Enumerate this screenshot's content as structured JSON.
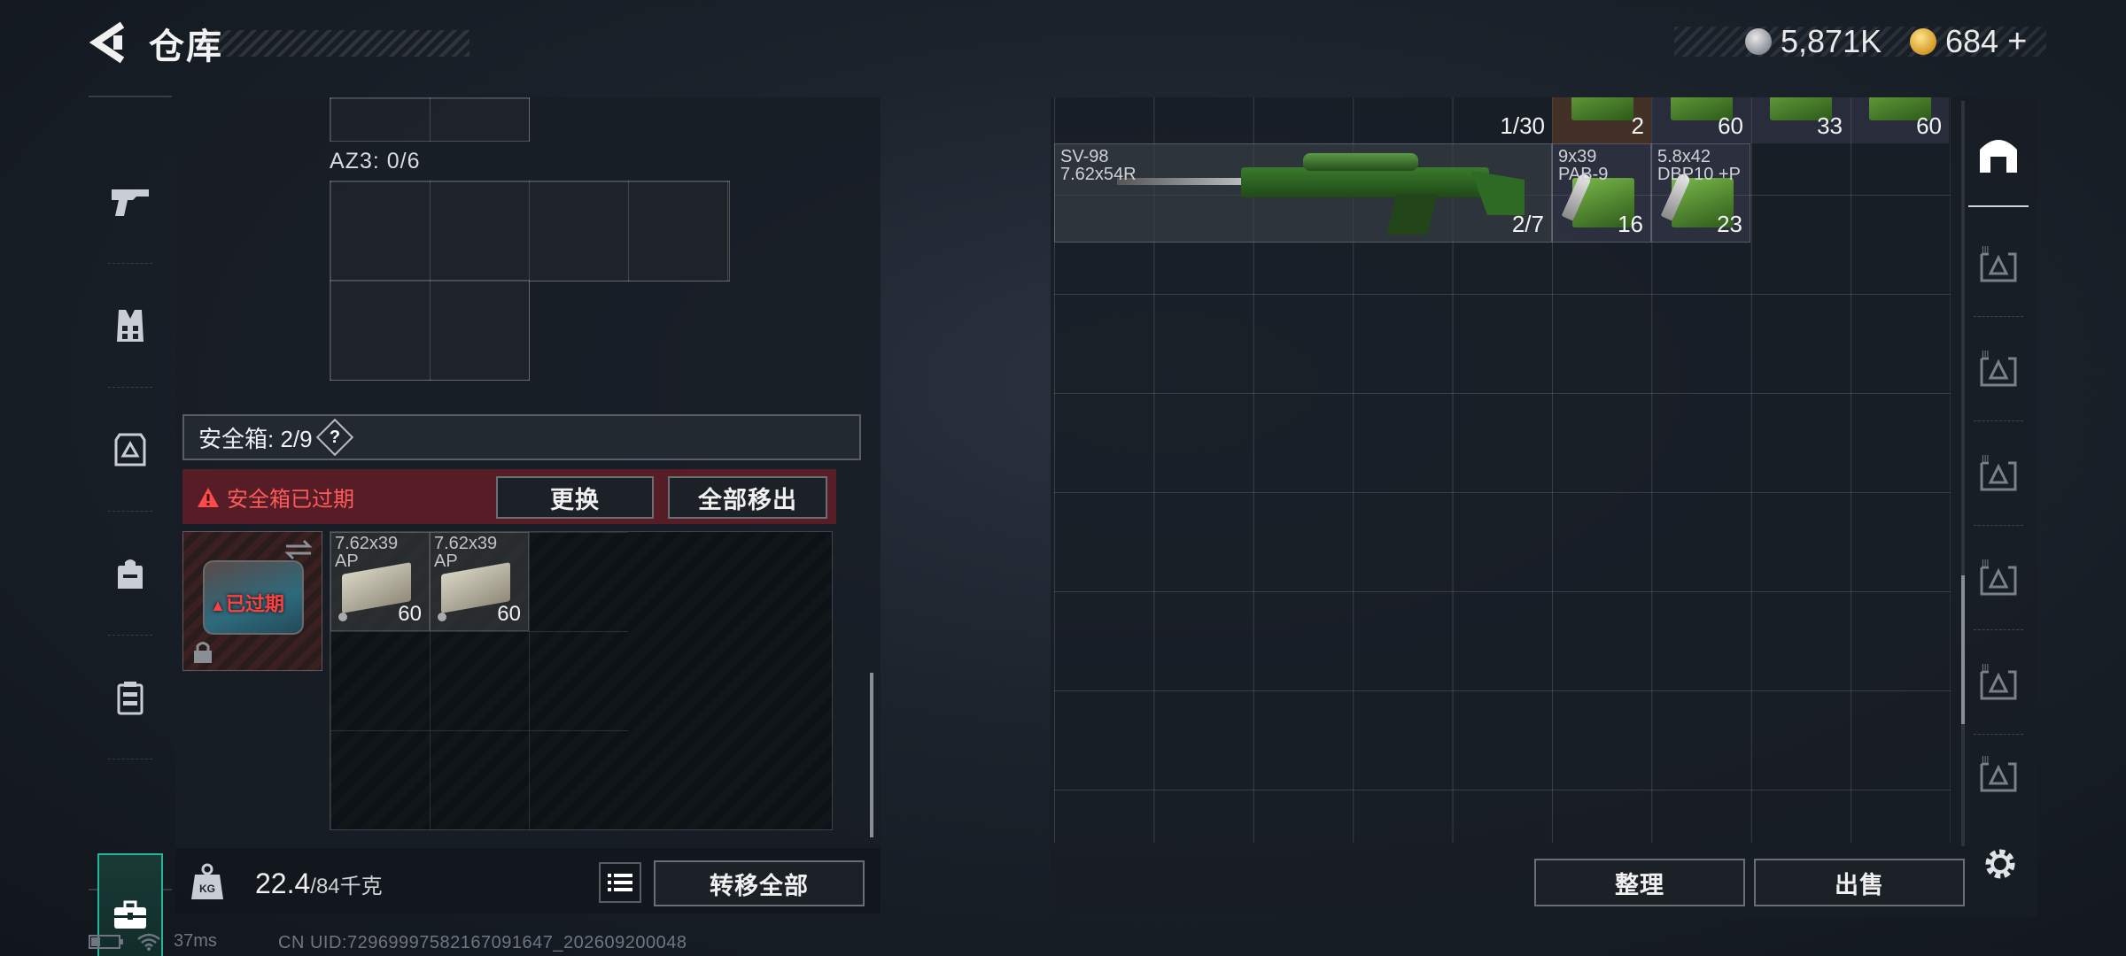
{
  "header": {
    "title": "仓库",
    "silver_amount": "5,871K",
    "gold_amount": "684",
    "add_symbol": "+"
  },
  "left_rail": {
    "items": [
      "weapon-icon",
      "vest-icon",
      "armor-icon",
      "backpack-icon",
      "rig-icon",
      "safe-case-icon"
    ],
    "active": "safe-case-icon"
  },
  "container": {
    "label": "AZ3: 0/6"
  },
  "safe_box": {
    "label": "安全箱: 2/9",
    "help": "?",
    "expired_warning": "安全箱已过期",
    "replace_button": "更换",
    "remove_all_button": "全部移出",
    "case_status": "已过期",
    "items": [
      {
        "name": "7.62x39\nAP",
        "count": "60"
      },
      {
        "name": "7.62x39\nAP",
        "count": "60"
      }
    ]
  },
  "weight": {
    "current": "22.4",
    "max": "/84千克",
    "transfer_all_button": "转移全部"
  },
  "stash": {
    "top_row": [
      "1/30",
      "2",
      "60",
      "33",
      "60"
    ],
    "rifle": {
      "name": "SV-98\n7.62x54R",
      "count": "2/7"
    },
    "ammo": [
      {
        "name": "9x39\nPAB-9",
        "count": "16"
      },
      {
        "name": "5.8x42\nDBP10 +P",
        "count": "23"
      }
    ],
    "organize_button": "整理",
    "sell_button": "出售"
  },
  "status": {
    "ping": "37ms",
    "uid": "CN UID:72969997582167091647_202609200048"
  },
  "colors": {
    "accent": "#27b59a",
    "warning": "#ff4a4a",
    "panel": "#181e26"
  }
}
